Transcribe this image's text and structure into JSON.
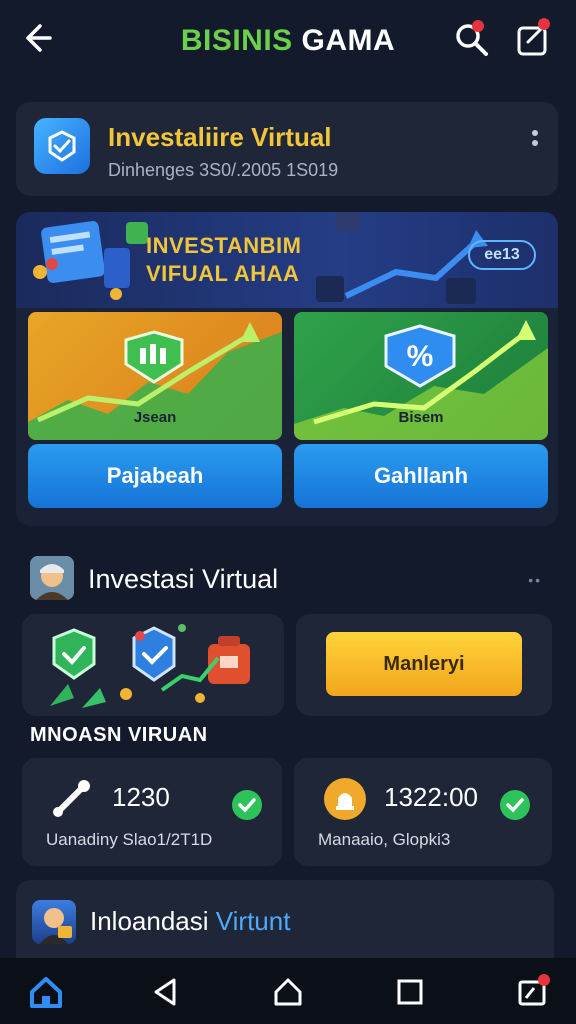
{
  "topbar": {
    "title_part1": "BISINIS",
    "title_part2": "GAMA",
    "back_icon": "back-arrow-icon",
    "search_icon": "search-icon",
    "share_icon": "share-icon"
  },
  "header_card": {
    "title": "Investaliire Virtual",
    "subtitle": "Dinhenges 3S0/.2005 1S019"
  },
  "promo": {
    "banner_title_line1": "INVESTANBIM",
    "banner_title_line2": "VIFUAL AHAA",
    "badge": "ee13",
    "tile1_label": "Jsean",
    "tile2_label": "Bisem",
    "button1": "Pajabeah",
    "button2": "Gahllanh"
  },
  "section2": {
    "title": "Investasi Virtual",
    "more": "••",
    "cta_button": "Manleryi",
    "caps_label": "MNOASN VIRUAN"
  },
  "stats": [
    {
      "value": "1230",
      "caption": "Uanadiny Slao1/2T1D",
      "icon": "tool-icon"
    },
    {
      "value": "1322:00",
      "caption": "Manaaio, Glopki3",
      "icon": "bell-icon"
    }
  ],
  "bottom_card": {
    "title_part1": "Inloandasi",
    "title_part2": "Virtunt"
  },
  "colors": {
    "background": "#121a2b",
    "card": "#1e2638",
    "accent_gold": "#f2c53a",
    "accent_blue": "#2a9cf0",
    "accent_green": "#2ec25a"
  }
}
